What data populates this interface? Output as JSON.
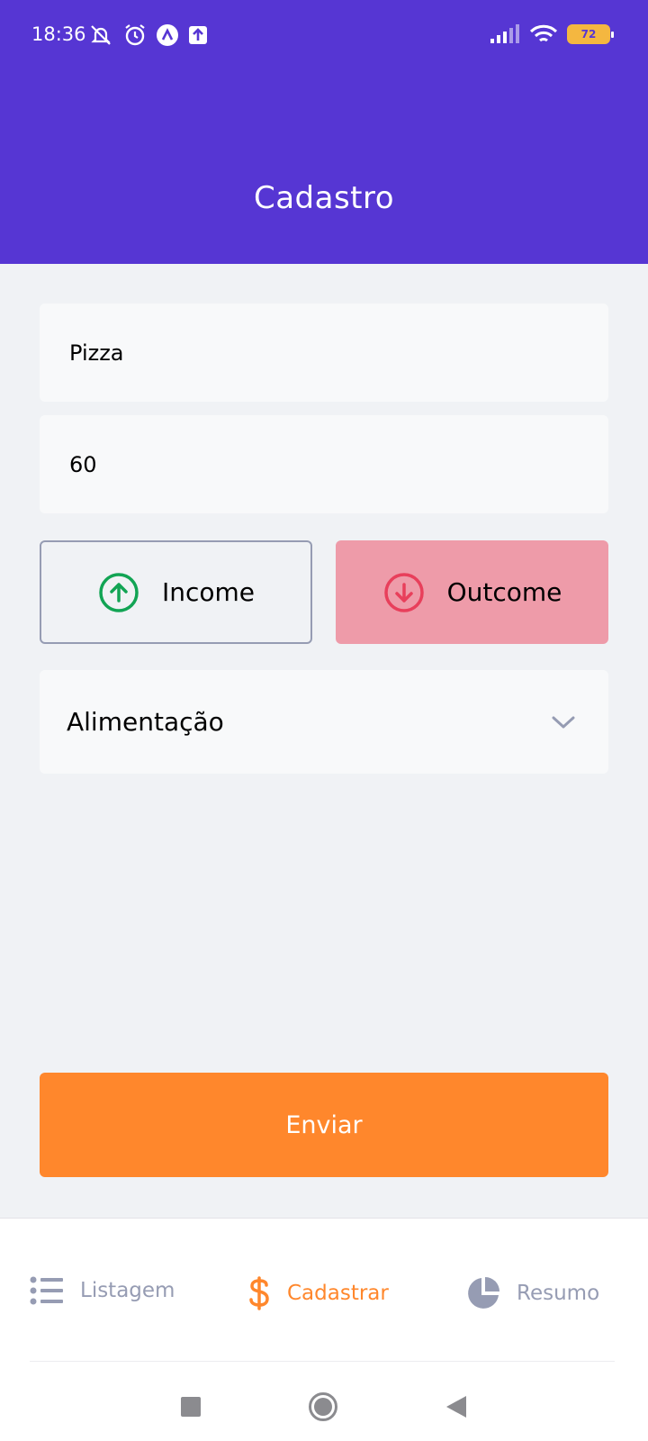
{
  "status_bar": {
    "time": "18:36",
    "battery_level": "72",
    "icons": [
      "mute-icon",
      "alarm-icon",
      "app-notification-icon",
      "upload-icon",
      "signal-icon",
      "wifi-icon",
      "battery-icon"
    ]
  },
  "header": {
    "title": "Cadastro"
  },
  "form": {
    "name_value": "Pizza",
    "amount_value": "60",
    "income_label": "Income",
    "outcome_label": "Outcome",
    "category_value": "Alimentação",
    "submit_label": "Enviar"
  },
  "nav": {
    "items": [
      {
        "label": "Listagem",
        "icon": "list-icon"
      },
      {
        "label": "Cadastrar",
        "icon": "dollar-icon"
      },
      {
        "label": "Resumo",
        "icon": "pie-chart-icon"
      }
    ]
  },
  "colors": {
    "primary": "#5636d3",
    "accent": "#ff872c",
    "income": "#12a454",
    "outcome": "#e83f5b",
    "outcome_bg": "#ee9ba9",
    "muted": "#969cb3"
  }
}
